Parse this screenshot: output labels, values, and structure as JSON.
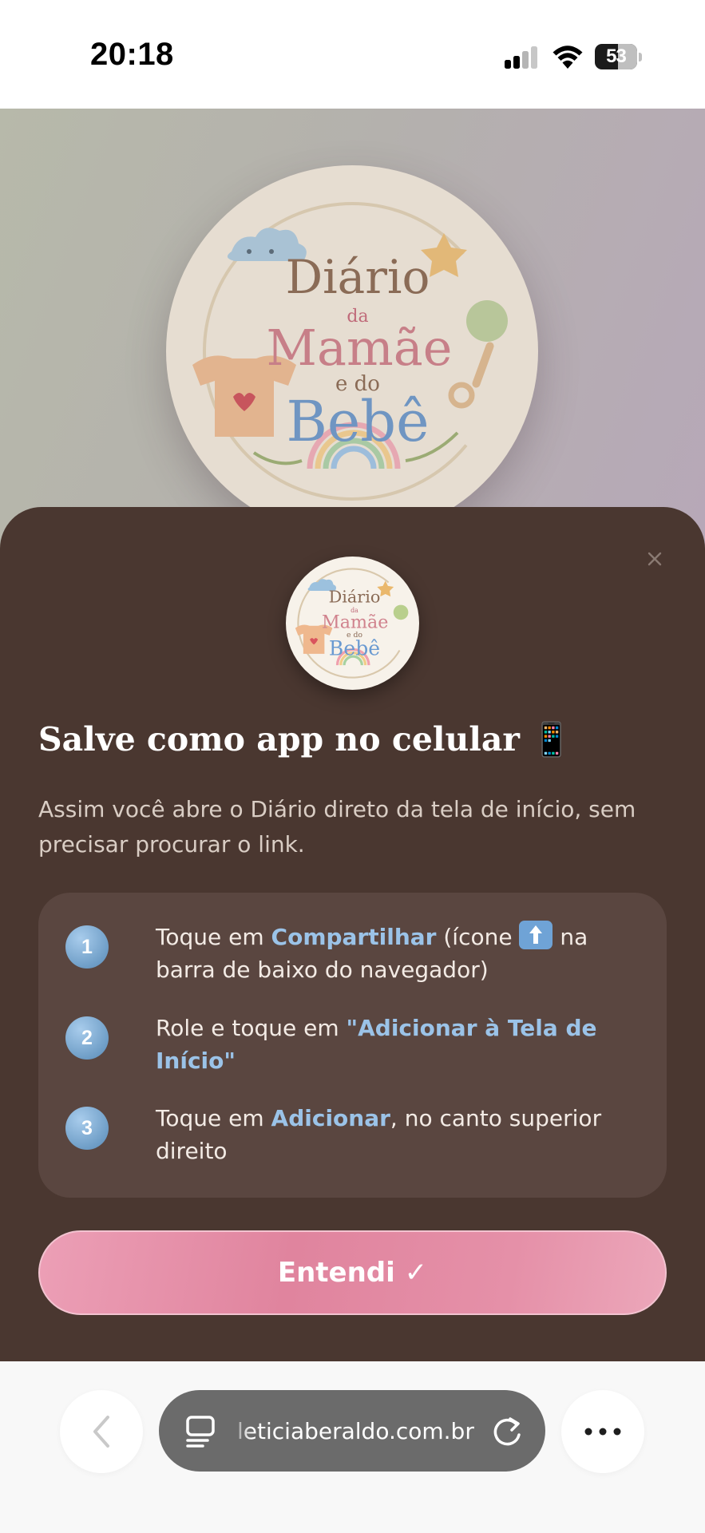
{
  "status_bar": {
    "time": "20:18",
    "battery_level": "53",
    "icons": [
      "cellular-signal-icon",
      "wifi-icon",
      "battery-icon"
    ]
  },
  "background_page": {
    "logo": {
      "line1": "Diário",
      "line2": "da",
      "line3": "Mamãe",
      "line4": "e do",
      "line5": "Bebê"
    }
  },
  "install_sheet": {
    "close_icon": "close-icon",
    "logo": {
      "line1": "Diário",
      "line2": "da",
      "line3": "Mamãe",
      "line4": "e do",
      "line5": "Bebê"
    },
    "title": "Salve como app no celular",
    "title_emoji": "📱",
    "subtitle": "Assim você abre o Diário direto da tela de início, sem precisar procurar o link.",
    "steps": [
      {
        "number": "1",
        "prefix": "Toque em ",
        "highlight": "Compartilhar",
        "middle": " (ícone ",
        "icon": "share-icon",
        "suffix": " na barra de baixo do navegador)"
      },
      {
        "number": "2",
        "prefix": "Role e toque em ",
        "highlight": "\"Adicionar à Tela de Início\"",
        "suffix": ""
      },
      {
        "number": "3",
        "prefix": "Toque em ",
        "highlight": "Adicionar",
        "suffix": ", no canto superior direito"
      }
    ],
    "confirm_button": "Entendi ✓"
  },
  "browser_toolbar": {
    "url": "leticiaberaldo.com.br",
    "icons": [
      "back-chevron-icon",
      "tabs-icon",
      "reload-icon",
      "more-icon"
    ]
  },
  "colors": {
    "sheet_background": "#4a3730",
    "steps_card": "#5a4640",
    "highlight_blue": "#9bc3e8",
    "button_pink": "#e0849e"
  }
}
